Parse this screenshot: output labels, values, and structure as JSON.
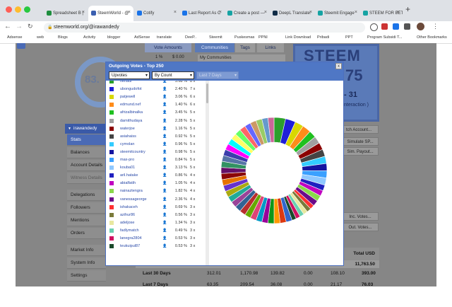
{
  "browser": {
    "tabs": [
      {
        "label": "Spreadsheet B |",
        "color": "#1e8e3e"
      },
      {
        "label": "SteemWorld - @",
        "color": "#3b5fb0",
        "active": true
      },
      {
        "label": "Cotify",
        "color": "#1a73e8"
      },
      {
        "label": "Last Report As C",
        "color": "#1a73e8"
      },
      {
        "label": "Create a post —",
        "color": "#16a3a3"
      },
      {
        "label": "DeepL Translate:",
        "color": "#0f2b46"
      },
      {
        "label": "Steemit Engage",
        "color": "#16a3a3"
      },
      {
        "label": "STEEM FOR BET",
        "color": "#16a3a3"
      }
    ],
    "url": "steemworld.org/@irawandedy",
    "bookmarks": [
      "Adsense",
      "web",
      "Blogs",
      "Activity",
      "blogger",
      "AdSense",
      "translate",
      "DeeP..",
      "Steemit",
      "Puskesmas",
      "PPNI",
      "Link Download",
      "Pribadi",
      "PPT",
      "Program Subsidi T...",
      "Other Bookmarks"
    ]
  },
  "page": {
    "top_buttons": {
      "vote_amounts": "Vote Amounts",
      "communities": "Communities",
      "tags": "Tags",
      "links": "Links"
    },
    "vote_row": {
      "value1": "1 %",
      "value2": "$ 0.00"
    },
    "my_communities": "My Communities",
    "gauge_value": "83.",
    "steem_banner": {
      "title": "STEEM",
      "sub": "75",
      "range": "- 31",
      "note": "nteraction )"
    },
    "profile": {
      "name": "irawandedy"
    },
    "sidebar": [
      "Stats",
      "Balances",
      "Account Details",
      "Witness Details",
      "Delegations",
      "Followers",
      "Mentions",
      "Orders",
      "Market Info",
      "System Info",
      "Settings"
    ],
    "right_buttons": [
      "tch Account...",
      "Simulate SP...",
      "Sim. Payout...",
      "Inc. Votes...",
      "Out. Votes..."
    ],
    "table": {
      "header_total": "Total USD",
      "total_value": "11,763.50",
      "rows": [
        {
          "label": "Last 30 Days",
          "c1": "312.01",
          "c2": "1,170.98",
          "c3": "139.82",
          "c4": "0.00",
          "c5": "108.10",
          "c6": "393.00"
        },
        {
          "label": "Last 7 Days",
          "c1": "63.35",
          "c2": "209.54",
          "c3": "36.08",
          "c4": "0.00",
          "c5": "21.17",
          "c6": "76.03"
        }
      ]
    }
  },
  "modal": {
    "title": "Outgoing Votes - Top 250",
    "close_label": "x",
    "filter": "Upvotes",
    "sort": "By Count",
    "range": "Last 7 Days",
    "rows": [
      {
        "name": "heriadi",
        "pct": "5.68 %",
        "count": "8 x",
        "color": "#2ca02c"
      },
      {
        "name": "ubongudofot",
        "pct": "2.40 %",
        "count": "7 x",
        "color": "#1f1fd8"
      },
      {
        "name": "patjewell",
        "pct": "3.06 %",
        "count": "6 x",
        "color": "#d8d800"
      },
      {
        "name": "edmund.nef",
        "pct": "1.40 %",
        "count": "6 x",
        "color": "#ff8c1a"
      },
      {
        "name": "afrizalbinalka",
        "pct": "3.45 %",
        "count": "5 x",
        "color": "#1fc01f"
      },
      {
        "name": "damithudaya",
        "pct": "2.28 %",
        "count": "5 x",
        "color": "#a0a0a0"
      },
      {
        "name": "waterjoe",
        "pct": "1.16 %",
        "count": "5 x",
        "color": "#8b0000"
      },
      {
        "name": "asiahaiss",
        "pct": "0.92 %",
        "count": "5 x",
        "color": "#444444"
      },
      {
        "name": "cymolan",
        "pct": "0.96 %",
        "count": "5 x",
        "color": "#33ccff"
      },
      {
        "name": "steemitcountry",
        "pct": "0.98 %",
        "count": "5 x",
        "color": "#1414a0"
      },
      {
        "name": "max-pro",
        "pct": "0.84 %",
        "count": "5 x",
        "color": "#3aa0ff"
      },
      {
        "name": "kouba01",
        "pct": "3.13 %",
        "count": "5 x",
        "color": "#8fc8ff"
      },
      {
        "name": "aril.hatake",
        "pct": "0.86 %",
        "count": "4 x",
        "color": "#2020c0"
      },
      {
        "name": "abialfatih",
        "pct": "1.05 %",
        "count": "4 x",
        "color": "#c000c0"
      },
      {
        "name": "nainaztengra",
        "pct": "1.82 %",
        "count": "4 x",
        "color": "#8ad84a"
      },
      {
        "name": "vanessageorge",
        "pct": "2.36 %",
        "count": "4 x",
        "color": "#6a0a8a"
      },
      {
        "name": "ishakaceh",
        "pct": "0.69 %",
        "count": "3 x",
        "color": "#ff3030"
      },
      {
        "name": "azihur86",
        "pct": "0.56 %",
        "count": "3 x",
        "color": "#7a7a3a"
      },
      {
        "name": "adeljose",
        "pct": "1.34 %",
        "count": "3 x",
        "color": "#e8e8a0"
      },
      {
        "name": "fadlymatch",
        "pct": "0.49 %",
        "count": "3 x",
        "color": "#6ad0b0"
      },
      {
        "name": "lanegra2804",
        "pct": "0.53 %",
        "count": "3 x",
        "color": "#d01060"
      },
      {
        "name": "teukuipul87",
        "pct": "0.53 %",
        "count": "3 x",
        "color": "#1a4a2a"
      }
    ]
  },
  "chart_data": {
    "type": "pie",
    "title": "",
    "donut": true,
    "slices": [
      {
        "label": "heriadi",
        "value": 8,
        "color": "#2ca02c"
      },
      {
        "label": "ubongudofot",
        "value": 7,
        "color": "#1f1fd8"
      },
      {
        "label": "patjewell",
        "value": 6,
        "color": "#d8d800"
      },
      {
        "label": "edmund.nef",
        "value": 6,
        "color": "#ff8c1a"
      },
      {
        "label": "afrizalbinalka",
        "value": 5,
        "color": "#1fc01f"
      },
      {
        "label": "damithudaya",
        "value": 5,
        "color": "#a0a0a0"
      },
      {
        "label": "waterjoe",
        "value": 5,
        "color": "#8b0000"
      },
      {
        "label": "asiahaiss",
        "value": 5,
        "color": "#444444"
      },
      {
        "label": "cymolan",
        "value": 5,
        "color": "#33ccff"
      },
      {
        "label": "steemitcountry",
        "value": 5,
        "color": "#1414a0"
      },
      {
        "label": "max-pro",
        "value": 5,
        "color": "#3aa0ff"
      },
      {
        "label": "kouba01",
        "value": 5,
        "color": "#8fc8ff"
      },
      {
        "label": "aril.hatake",
        "value": 4,
        "color": "#2020c0"
      },
      {
        "label": "abialfatih",
        "value": 4,
        "color": "#c000c0"
      },
      {
        "label": "nainaztengra",
        "value": 4,
        "color": "#8ad84a"
      },
      {
        "label": "vanessageorge",
        "value": 4,
        "color": "#6a0a8a"
      },
      {
        "label": "ishakaceh",
        "value": 3,
        "color": "#ff3030"
      },
      {
        "label": "azihur86",
        "value": 3,
        "color": "#7a7a3a"
      },
      {
        "label": "adeljose",
        "value": 3,
        "color": "#e8e8a0"
      },
      {
        "label": "fadlymatch",
        "value": 3,
        "color": "#6ad0b0"
      },
      {
        "label": "lanegra2804",
        "value": 3,
        "color": "#d01060"
      },
      {
        "label": "teukuipul87",
        "value": 3,
        "color": "#1a4a2a"
      }
    ]
  }
}
